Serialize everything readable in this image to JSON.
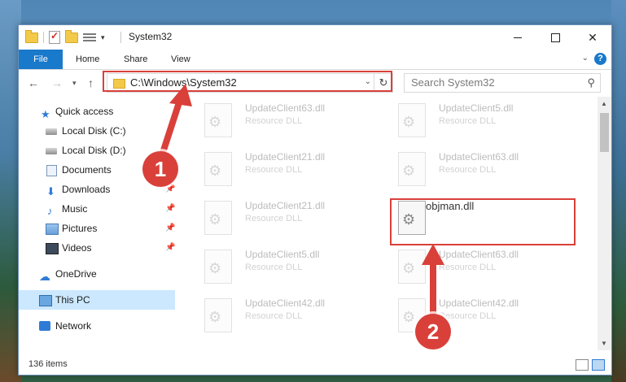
{
  "window": {
    "title": "System32",
    "controls": {
      "minimize": "minimize-icon",
      "maximize": "maximize-icon",
      "close": "close-icon"
    }
  },
  "quick_access_toolbar": {
    "icons": [
      "folder-icon",
      "checkmark-icon",
      "folder-icon",
      "properties-icon"
    ]
  },
  "ribbon": {
    "tabs": [
      {
        "label": "File"
      },
      {
        "label": "Home"
      },
      {
        "label": "Share"
      },
      {
        "label": "View"
      }
    ],
    "help": "?"
  },
  "address": {
    "path": "C:\\Windows\\System32",
    "search_placeholder": "Search System32"
  },
  "navigation": {
    "items": [
      {
        "label": "Quick access",
        "icon": "star-icon"
      },
      {
        "label": "Local Disk (C:)",
        "icon": "drive-icon"
      },
      {
        "label": "Local Disk (D:)",
        "icon": "drive-icon"
      },
      {
        "label": "Documents",
        "icon": "documents-icon"
      },
      {
        "label": "Downloads",
        "icon": "download-icon"
      },
      {
        "label": "Music",
        "icon": "music-icon"
      },
      {
        "label": "Pictures",
        "icon": "pictures-icon"
      },
      {
        "label": "Videos",
        "icon": "videos-icon"
      },
      {
        "label": "OneDrive",
        "icon": "cloud-icon"
      },
      {
        "label": "This PC",
        "icon": "computer-icon"
      },
      {
        "label": "Network",
        "icon": "network-icon"
      }
    ]
  },
  "files": [
    {
      "name": "UpdateClient63.dll",
      "type": "Resource DLL"
    },
    {
      "name": "UpdateClient5.dll",
      "type": "Resource DLL"
    },
    {
      "name": "UpdateClient21.dll",
      "type": "Resource DLL"
    },
    {
      "name": "UpdateClient63.dll",
      "type": "Resource DLL"
    },
    {
      "name": "UpdateClient21.dll",
      "type": "Resource DLL"
    },
    {
      "name": "objman.dll",
      "type": ""
    },
    {
      "name": "UpdateClient5.dll",
      "type": "Resource DLL"
    },
    {
      "name": "UpdateClient63.dll",
      "type": "Resource DLL"
    },
    {
      "name": "UpdateClient42.dll",
      "type": "Resource DLL"
    },
    {
      "name": "UpdateClient42.dll",
      "type": "Resource DLL"
    }
  ],
  "status": {
    "items_count": "136 items"
  },
  "annotations": {
    "step1": "1",
    "step2": "2",
    "color": "#d9403a"
  }
}
